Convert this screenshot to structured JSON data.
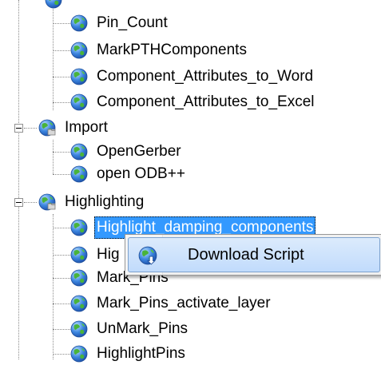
{
  "tree": {
    "items": [
      {
        "label": "Pin_Count",
        "type": "script"
      },
      {
        "label": "MarkPTHComponents",
        "type": "script"
      },
      {
        "label": "Component_Attributes_to_Word",
        "type": "script"
      },
      {
        "label": "Component_Attributes_to_Excel",
        "type": "script"
      },
      {
        "label": "Import",
        "type": "folder",
        "expanded": true
      },
      {
        "label": "OpenGerber",
        "type": "script"
      },
      {
        "label": "open ODB++",
        "type": "script"
      },
      {
        "label": "Highlighting",
        "type": "folder",
        "expanded": true
      },
      {
        "label": "Highlight_damping_components",
        "type": "script",
        "selected": true
      },
      {
        "label": "Hig",
        "type": "script"
      },
      {
        "label": "Mark_Pins",
        "type": "script"
      },
      {
        "label": "Mark_Pins_activate_layer",
        "type": "script"
      },
      {
        "label": "UnMark_Pins",
        "type": "script"
      },
      {
        "label": "HighlightPins",
        "type": "script"
      }
    ],
    "icons": {
      "script": "globe-icon",
      "folder": "globe-folder-icon"
    }
  },
  "context_menu": {
    "items": [
      {
        "label": "Download Script",
        "icon": "globe-download-icon"
      }
    ]
  },
  "colors": {
    "selection": "#3399ff",
    "menu_hover": "#c1dbfc",
    "globe_blue": "#2f6fd0",
    "globe_green": "#3fa92f"
  }
}
